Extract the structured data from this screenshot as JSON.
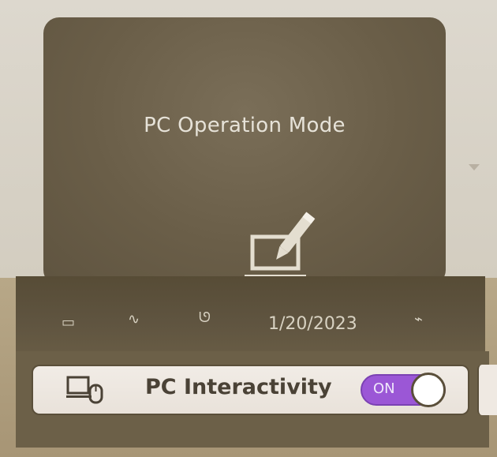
{
  "dialog": {
    "title": "PC Operation Mode",
    "icon": "laptop-pen-icon"
  },
  "taskbar": {
    "date": "1/20/2023",
    "icons": [
      "network-icon",
      "bluetooth-icon",
      "volume-icon",
      "notification-icon"
    ]
  },
  "interactivity": {
    "icon": "laptop-mouse-icon",
    "label": "PC Interactivity",
    "toggle_state": "ON",
    "accent_color": "#9b57d6"
  }
}
